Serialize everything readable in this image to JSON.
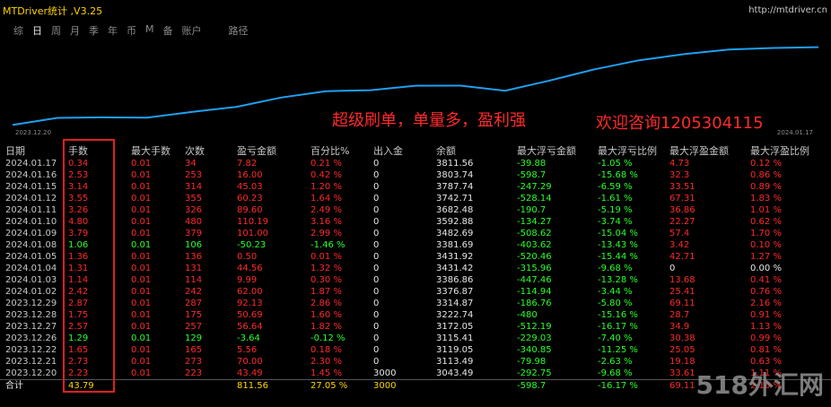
{
  "app": {
    "title": "MTDriver统计 ,V3.25",
    "url": "http://mtdriver.cn"
  },
  "tabs": [
    "综",
    "日",
    "周",
    "月",
    "季",
    "年",
    "币",
    "M",
    "备",
    "账户",
    "路径"
  ],
  "active_tab": "日",
  "chart": {
    "start_date": "2023.12.20",
    "end_date": "2024.01.17",
    "line_color": "#1ea0f0",
    "balance_points": [
      3043.49,
      3113.49,
      3119.05,
      3115.41,
      3172.05,
      3222.74,
      3314.87,
      3376.87,
      3386.86,
      3431.42,
      3431.92,
      3381.69,
      3482.69,
      3592.88,
      3682.48,
      3742.71,
      3787.74,
      3803.74,
      3811.56
    ]
  },
  "promo": {
    "text1": "超级刷单，单量多，盈利强",
    "text2": "欢迎咨询1205304115"
  },
  "columns": [
    "日期",
    "手数",
    "最大手数",
    "次数",
    "盈亏金额",
    "百分比%",
    "出入金",
    "余额",
    "最大浮亏金额",
    "最大浮亏比例",
    "最大浮盈金额",
    "最大浮盈比例"
  ],
  "rows": [
    [
      "2024.01.17",
      "0.34",
      "0.01",
      "34",
      "7.82",
      "0.21 %",
      "0",
      "3811.56",
      "-39.88",
      "-1.05 %",
      "4.73",
      "0.12 %"
    ],
    [
      "2024.01.16",
      "2.53",
      "0.01",
      "253",
      "16.00",
      "0.42 %",
      "0",
      "3803.74",
      "-598.7",
      "-15.68 %",
      "32.3",
      "0.86 %"
    ],
    [
      "2024.01.15",
      "3.14",
      "0.01",
      "314",
      "45.03",
      "1.20 %",
      "0",
      "3787.74",
      "-247.29",
      "-6.59 %",
      "33.51",
      "0.89 %"
    ],
    [
      "2024.01.12",
      "3.55",
      "0.01",
      "355",
      "60.23",
      "1.64 %",
      "0",
      "3742.71",
      "-528.14",
      "-1.61 %",
      "67.31",
      "1.83 %"
    ],
    [
      "2024.01.11",
      "3.26",
      "0.01",
      "326",
      "89.60",
      "2.49 %",
      "0",
      "3682.48",
      "-190.7",
      "-5.19 %",
      "36.86",
      "1.01 %"
    ],
    [
      "2024.01.10",
      "4.80",
      "0.01",
      "480",
      "110.19",
      "3.16 %",
      "0",
      "3592.88",
      "-134.27",
      "-3.74 %",
      "22.27",
      "0.62 %"
    ],
    [
      "2024.01.09",
      "3.79",
      "0.01",
      "379",
      "101.00",
      "2.99 %",
      "0",
      "3482.69",
      "-508.62",
      "-15.04 %",
      "57.4",
      "1.70 %"
    ],
    [
      "2024.01.08",
      "1.06",
      "0.01",
      "106",
      "-50.23",
      "-1.46 %",
      "0",
      "3381.69",
      "-403.62",
      "-13.43 %",
      "3.42",
      "0.10 %"
    ],
    [
      "2024.01.05",
      "1.36",
      "0.01",
      "136",
      "0.50",
      "0.01 %",
      "0",
      "3431.92",
      "-520.46",
      "-15.44 %",
      "42.71",
      "1.27 %"
    ],
    [
      "2024.01.04",
      "1.31",
      "0.01",
      "131",
      "44.56",
      "1.32 %",
      "0",
      "3431.42",
      "-315.96",
      "-9.68 %",
      "0",
      "0.00 %"
    ],
    [
      "2024.01.03",
      "1.14",
      "0.01",
      "114",
      "9.99",
      "0.30 %",
      "0",
      "3386.86",
      "-447.46",
      "-13.28 %",
      "13.68",
      "0.41 %"
    ],
    [
      "2024.01.02",
      "2.42",
      "0.01",
      "242",
      "62.00",
      "1.87 %",
      "0",
      "3376.87",
      "-114.94",
      "-3.44 %",
      "25.41",
      "0.76 %"
    ],
    [
      "2023.12.29",
      "2.87",
      "0.01",
      "287",
      "92.13",
      "2.86 %",
      "0",
      "3314.87",
      "-186.76",
      "-5.80 %",
      "69.11",
      "2.16 %"
    ],
    [
      "2023.12.28",
      "1.75",
      "0.01",
      "175",
      "50.69",
      "1.60 %",
      "0",
      "3222.74",
      "-480",
      "-15.16 %",
      "28.7",
      "0.91 %"
    ],
    [
      "2023.12.27",
      "2.57",
      "0.01",
      "257",
      "56.64",
      "1.82 %",
      "0",
      "3172.05",
      "-512.19",
      "-16.17 %",
      "34.9",
      "1.13 %"
    ],
    [
      "2023.12.26",
      "1.29",
      "0.01",
      "129",
      "-3.64",
      "-0.12 %",
      "0",
      "3115.41",
      "-229.03",
      "-7.40 %",
      "30.38",
      "0.99 %"
    ],
    [
      "2023.12.22",
      "1.65",
      "0.01",
      "165",
      "5.56",
      "0.18 %",
      "0",
      "3119.05",
      "-340.85",
      "-11.25 %",
      "25.05",
      "0.81 %"
    ],
    [
      "2023.12.21",
      "2.73",
      "0.01",
      "273",
      "70.00",
      "2.30 %",
      "0",
      "3113.49",
      "-79.98",
      "-2.63 %",
      "19.18",
      "0.63 %"
    ],
    [
      "2023.12.20",
      "2.23",
      "0.01",
      "223",
      "43.49",
      "1.45 %",
      "3000",
      "3043.49",
      "-292.75",
      "-9.68 %",
      "33.61",
      "1.11 %"
    ]
  ],
  "total": [
    "合计",
    "43.79",
    "",
    "",
    "811.56",
    "27.05 %",
    "3000",
    "",
    "-598.7",
    "-16.17 %",
    "69.11",
    "2.16 %"
  ],
  "watermark": "518外汇网",
  "colors": {
    "positive": "#ff2a2a",
    "negative": "#2aff2a",
    "title": "#ffd400",
    "highlight_box": "#e0201a"
  }
}
